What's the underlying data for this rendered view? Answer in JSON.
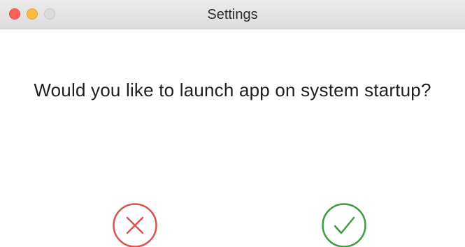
{
  "window": {
    "title": "Settings"
  },
  "dialog": {
    "question": "Would you like to launch app on system startup?"
  },
  "buttons": {
    "cancel_icon": "x-icon",
    "confirm_icon": "checkmark-icon"
  },
  "colors": {
    "cancel": "#d9534f",
    "confirm": "#3f9a45",
    "traffic_close": "#fc605c",
    "traffic_minimize": "#fdbc40",
    "traffic_zoom_disabled": "#dcdcdc"
  }
}
